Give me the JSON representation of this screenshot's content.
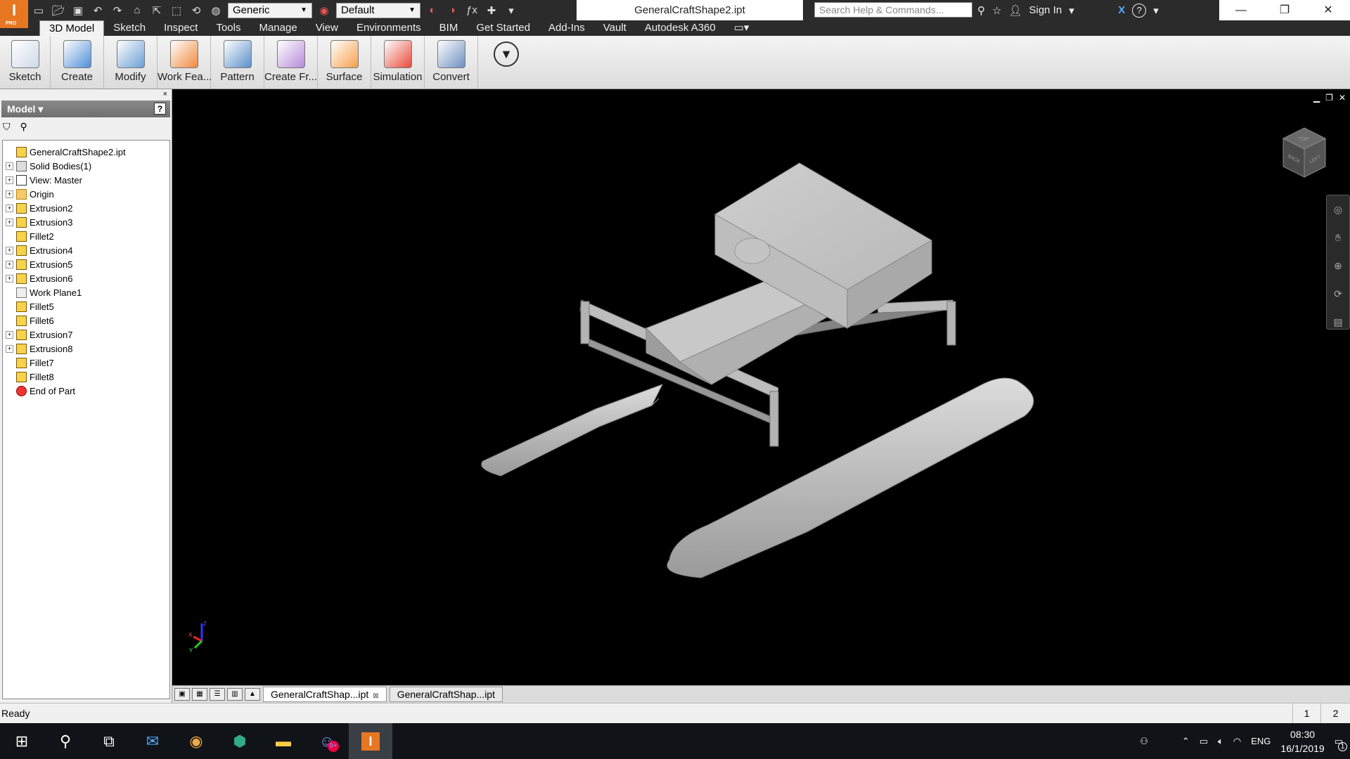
{
  "app": {
    "logo": "I",
    "logo_sub": "PRO"
  },
  "qat": {
    "material": "Generic",
    "appearance": "Default",
    "fx": "ƒx"
  },
  "document_title": "GeneralCraftShape2.ipt",
  "search": {
    "placeholder": "Search Help & Commands..."
  },
  "account": {
    "sign_in": "Sign In",
    "help": "?"
  },
  "window": {
    "minimize": "—",
    "restore": "❐",
    "close": "✕"
  },
  "tabs": [
    "3D Model",
    "Sketch",
    "Inspect",
    "Tools",
    "Manage",
    "View",
    "Environments",
    "BIM",
    "Get Started",
    "Add-Ins",
    "Vault",
    "Autodesk A360"
  ],
  "ribbon": [
    {
      "label": "Sketch",
      "color": "#cfd8e8"
    },
    {
      "label": "Create",
      "color": "#4f8fd8"
    },
    {
      "label": "Modify",
      "color": "#6b9fd6"
    },
    {
      "label": "Work Fea...",
      "color": "#f08a3e"
    },
    {
      "label": "Pattern",
      "color": "#5b8fc9"
    },
    {
      "label": "Create Fr...",
      "color": "#b68ad9"
    },
    {
      "label": "Surface",
      "color": "#f5a04a"
    },
    {
      "label": "Simulation",
      "color": "#e84a3a"
    },
    {
      "label": "Convert",
      "color": "#6d8fc0"
    }
  ],
  "browser": {
    "header": "Model ▾",
    "help": "?",
    "close": "×",
    "filter_icon": "⛉",
    "find_icon": "⚲",
    "items": [
      {
        "label": "GeneralCraftShape2.ipt",
        "expander": "",
        "icon": "part"
      },
      {
        "label": "Solid Bodies(1)",
        "expander": "+",
        "icon": "body"
      },
      {
        "label": "View: Master",
        "expander": "+",
        "icon": "view"
      },
      {
        "label": "Origin",
        "expander": "+",
        "icon": "folder"
      },
      {
        "label": "Extrusion2",
        "expander": "+",
        "icon": "feature"
      },
      {
        "label": "Extrusion3",
        "expander": "+",
        "icon": "feature"
      },
      {
        "label": "Fillet2",
        "expander": "",
        "icon": "feature"
      },
      {
        "label": "Extrusion4",
        "expander": "+",
        "icon": "feature"
      },
      {
        "label": "Extrusion5",
        "expander": "+",
        "icon": "feature"
      },
      {
        "label": "Extrusion6",
        "expander": "+",
        "icon": "feature"
      },
      {
        "label": "Work Plane1",
        "expander": "",
        "icon": "plane"
      },
      {
        "label": "Fillet5",
        "expander": "",
        "icon": "feature"
      },
      {
        "label": "Fillet6",
        "expander": "",
        "icon": "feature"
      },
      {
        "label": "Extrusion7",
        "expander": "+",
        "icon": "feature"
      },
      {
        "label": "Extrusion8",
        "expander": "+",
        "icon": "feature"
      },
      {
        "label": "Fillet7",
        "expander": "",
        "icon": "feature"
      },
      {
        "label": "Fillet8",
        "expander": "",
        "icon": "feature"
      },
      {
        "label": "End of Part",
        "expander": "",
        "icon": "end"
      }
    ]
  },
  "viewcube": {
    "face1": "BACK",
    "face2": "LEFT",
    "face3": "TOP"
  },
  "triad": {
    "x": "X",
    "y": "Y",
    "z": "Z"
  },
  "doc_tabs": [
    {
      "label": "GeneralCraftShap...ipt",
      "active": true,
      "close": "⊠"
    },
    {
      "label": "GeneralCraftShap...ipt",
      "active": false
    }
  ],
  "status": {
    "text": "Ready",
    "page1": "1",
    "page2": "2"
  },
  "taskbar": {
    "lang": "ENG",
    "time": "08:30",
    "date": "16/1/2019",
    "notifications": "1",
    "badge": "9+"
  }
}
